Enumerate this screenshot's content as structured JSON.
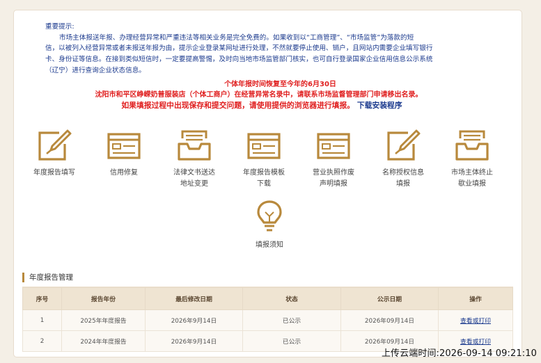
{
  "notice": {
    "heading": "重要提示:",
    "line1": "市场主体报送年报、办理经营异常和严重违法等相关业务是完全免费的。如果收到以“工商管理”、“市场监管”为落款的短",
    "line2": "信，以被列入经营异常或者未报送年报为由，提示企业登录某网址进行处理，不然就要停止使用、销户，且网站内需要企业填写银行",
    "line3": "卡、身份证等信息。在接到类似短信时，一定要提高警惕，及时向当地市场监管部门核实，也可自行登录国家企业信用信息公示系统",
    "line4": "（辽宁）进行查询企业状态信息。"
  },
  "alerts": {
    "deadline": "个体年报时间恢复至今年的6月30日",
    "abnormal": "沈阳市和平区峥嵘奶普服装店（个体工商户）在经营异常名录中，请联系市场监督管理部门申请移出名录。",
    "browser_tip": "如果填报过程中出现保存和提交问题，请使用提供的浏览器进行填报。",
    "download_link": "下载安装程序"
  },
  "tiles": [
    {
      "l1": "年度报告填写",
      "l2": "",
      "icon": "pen-document-icon"
    },
    {
      "l1": "信用修复",
      "l2": "",
      "icon": "form-window-icon"
    },
    {
      "l1": "法律文书送达",
      "l2": "地址变更",
      "icon": "inbox-tray-icon"
    },
    {
      "l1": "年度报告模板",
      "l2": "下载",
      "icon": "form-window-icon"
    },
    {
      "l1": "营业执照作废",
      "l2": "声明填报",
      "icon": "form-window-icon"
    },
    {
      "l1": "名称授权信息",
      "l2": "填报",
      "icon": "pen-document-icon"
    },
    {
      "l1": "市场主体终止",
      "l2": "歇业填报",
      "icon": "inbox-tray-icon"
    },
    {
      "l1": "填报须知",
      "l2": "",
      "icon": "lightbulb-icon"
    }
  ],
  "section_title": "年度报告管理",
  "table": {
    "headers": [
      "序号",
      "报告年份",
      "最后修改日期",
      "状态",
      "公示日期",
      "操作"
    ],
    "rows": [
      [
        "1",
        "2025年年度报告",
        "2026年9月14日",
        "已公示",
        "2026年09月14日",
        "查看或打印"
      ],
      [
        "2",
        "2024年年度报告",
        "2026年9月14日",
        "已公示",
        "2026年09月14日",
        "查看或打印"
      ]
    ]
  },
  "upload_time": "上传云端时间:2026-09-14 09:21:10",
  "colors": {
    "accent": "#b8893c",
    "alert": "#e02020",
    "link": "#1b3a8e"
  }
}
